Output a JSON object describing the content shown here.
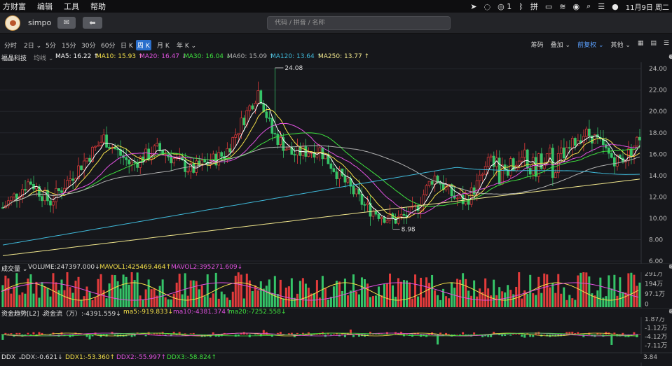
{
  "menubar": {
    "app_name": "方财富",
    "items": [
      "编辑",
      "工具",
      "帮助"
    ],
    "wechat_badge": "1",
    "datetime": "11月9日 周二"
  },
  "toolbar": {
    "username": "simpo",
    "mail_icon": "mail-icon",
    "back_icon": "back-arrow-icon",
    "search_placeholder": "代码 / 拼音 / 名称"
  },
  "periods": [
    {
      "label": "分时",
      "active": false
    },
    {
      "label": "2日 ⌄",
      "active": false
    },
    {
      "label": "5分",
      "active": false
    },
    {
      "label": "15分",
      "active": false
    },
    {
      "label": "30分",
      "active": false
    },
    {
      "label": "60分",
      "active": false
    },
    {
      "label": "日 K",
      "active": false
    },
    {
      "label": "周 K",
      "active": true
    },
    {
      "label": "月 K",
      "active": false
    },
    {
      "label": "年 K ⌄",
      "active": false
    }
  ],
  "right_controls": {
    "chip": "筹码",
    "overlay": "叠加 ⌄",
    "adjust": "前复权 ⌄",
    "other": "其他 ⌄"
  },
  "ma_legend": {
    "stock_name": "福晶科技",
    "type": "均线 ⌄",
    "items": [
      {
        "text": "MA5: 16.22 ↑",
        "color": "#ffffff"
      },
      {
        "text": "MA10: 15.93 ↑",
        "color": "#f4e04a"
      },
      {
        "text": "MA20: 16.47 ↓",
        "color": "#e052e0"
      },
      {
        "text": "MA30: 16.04 ↓",
        "color": "#3ee03e"
      },
      {
        "text": "MA60: 15.09 ↑",
        "color": "#b0b0b0"
      },
      {
        "text": "MA120: 13.64 ↑",
        "color": "#3fb8d8"
      },
      {
        "text": "MA250: 13.77 ↑",
        "color": "#f0e68c"
      }
    ]
  },
  "price_axis": [
    "24.00",
    "22.00",
    "20.00",
    "18.00",
    "16.00",
    "14.00",
    "12.00",
    "10.00",
    "8.00",
    "6.00"
  ],
  "annotations": {
    "high": "24.08",
    "low": "8.98"
  },
  "volume_legend": {
    "title": "成交量 ⌄",
    "items": [
      {
        "text": "VOLUME:247397.000↓",
        "color": "#dddddd"
      },
      {
        "text": "MAVOL1:425469.464↑",
        "color": "#f4e04a"
      },
      {
        "text": "MAVOL2:395271.609↓",
        "color": "#e052e0"
      }
    ]
  },
  "volume_axis": [
    "291万",
    "194万",
    "97.1万",
    "0"
  ],
  "fund_legend": {
    "title": "资金趋势[L2] ⌄",
    "items": [
      {
        "text": "资金流（万）:-4391.559↓",
        "color": "#dddddd"
      },
      {
        "text": "ma5:-919.833↓",
        "color": "#f4e04a"
      },
      {
        "text": "ma10:-4381.374↑",
        "color": "#e052e0"
      },
      {
        "text": "ma20:-7252.558↓",
        "color": "#3ee03e"
      }
    ]
  },
  "fund_axis": [
    "1.87万",
    "-1.12万",
    "-4.12万",
    "-7.11万"
  ],
  "ddx_legend": {
    "title": "DDX ⌄",
    "items": [
      {
        "text": "DDX:-0.621↓",
        "color": "#dddddd"
      },
      {
        "text": "DDX1:-53.360↑",
        "color": "#f4e04a"
      },
      {
        "text": "DDX2:-55.997↑",
        "color": "#e052e0"
      },
      {
        "text": "DDX3:-58.824↑",
        "color": "#3ee03e"
      }
    ]
  },
  "ddx_axis": [
    "3.84"
  ],
  "colors": {
    "up": "#e23b3b",
    "down": "#35c468",
    "bg": "#16171b",
    "accent": "#2b6fcc"
  }
}
